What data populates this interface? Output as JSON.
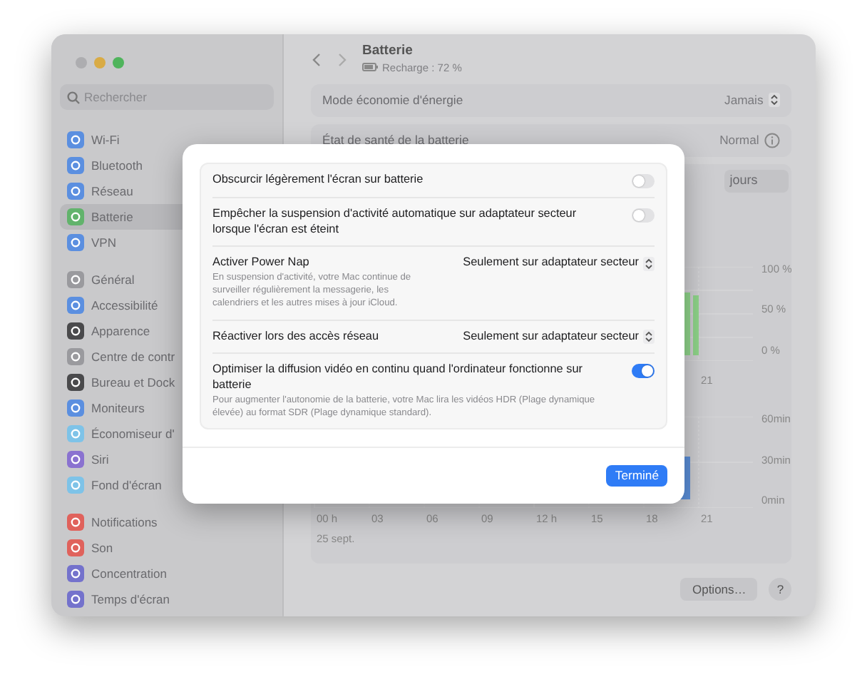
{
  "sidebar": {
    "search": {
      "placeholder": "Rechercher"
    },
    "groups": [
      {
        "items": [
          {
            "label": "Wi-Fi",
            "color": "#5b8fe0",
            "selected": false
          },
          {
            "label": "Bluetooth",
            "color": "#5b8fe0",
            "selected": false
          },
          {
            "label": "Réseau",
            "color": "#5b8fe0",
            "selected": false
          },
          {
            "label": "Batterie",
            "color": "#62b36c",
            "selected": true
          },
          {
            "label": "VPN",
            "color": "#5b8fe0",
            "selected": false
          }
        ]
      },
      {
        "items": [
          {
            "label": "Général",
            "color": "#9a9a9e",
            "selected": false
          },
          {
            "label": "Accessibilité",
            "color": "#5b8fe0",
            "selected": false
          },
          {
            "label": "Apparence",
            "color": "#4a4a4c",
            "selected": false
          },
          {
            "label": "Centre de contr",
            "color": "#9a9a9e",
            "selected": false
          },
          {
            "label": "Bureau et Dock",
            "color": "#4a4a4c",
            "selected": false
          },
          {
            "label": "Moniteurs",
            "color": "#5b8fe0",
            "selected": false
          },
          {
            "label": "Économiseur d'",
            "color": "#7ec3e8",
            "selected": false
          },
          {
            "label": "Siri",
            "color": "#8a72d0",
            "selected": false
          },
          {
            "label": "Fond d'écran",
            "color": "#7ec3e8",
            "selected": false
          }
        ]
      },
      {
        "items": [
          {
            "label": "Notifications",
            "color": "#e0625c",
            "selected": false
          },
          {
            "label": "Son",
            "color": "#e0625c",
            "selected": false
          },
          {
            "label": "Concentration",
            "color": "#7472cc",
            "selected": false
          },
          {
            "label": "Temps d'écran",
            "color": "#7472cc",
            "selected": false
          }
        ]
      }
    ]
  },
  "header": {
    "title": "Batterie",
    "subtitle": "Recharge : 72 %"
  },
  "settings": [
    {
      "label": "Mode économie d'énergie",
      "value": "Jamais",
      "kind": "popup"
    },
    {
      "label": "État de santé de la batterie",
      "value": "Normal",
      "kind": "info"
    }
  ],
  "range_tabs": [
    {
      "label": "jours",
      "selected": false
    }
  ],
  "level_chart": {
    "y_ticks": [
      "100 %",
      "50 %",
      "0 %"
    ],
    "x_ticks": [
      "21"
    ]
  },
  "usage_chart": {
    "y_ticks": [
      "60min",
      "30min",
      "0min"
    ],
    "x_ticks": [
      "00 h",
      "03",
      "06",
      "09",
      "12 h",
      "15",
      "18",
      "21"
    ],
    "date": "25 sept."
  },
  "footer_buttons": [
    {
      "label": "Options…"
    },
    {
      "label": "?"
    }
  ],
  "dialog": {
    "rows": [
      {
        "kind": "toggle",
        "label": "Obscurcir légèrement l'écran sur batterie",
        "on": false
      },
      {
        "kind": "toggle",
        "label": "Empêcher la suspension d'activité automatique sur adaptateur secteur lorsque l'écran est éteint",
        "on": false
      },
      {
        "kind": "popup",
        "label": "Activer Power Nap",
        "description": "En suspension d'activité, votre Mac continue de surveiller régulièrement la messagerie, les calendriers et les autres mises à jour iCloud.",
        "value": "Seulement sur adaptateur secteur"
      },
      {
        "kind": "popup",
        "label": "Réactiver lors des accès réseau",
        "value": "Seulement sur adaptateur secteur"
      },
      {
        "kind": "toggle",
        "label": "Optimiser la diffusion vidéo en continu quand l'ordinateur fonctionne sur batterie",
        "description": "Pour augmenter l'autonomie de la batterie, votre Mac lira les vidéos HDR (Plage dynamique élevée) au format SDR (Plage dynamique standard).",
        "on": true
      }
    ],
    "done_button": "Terminé"
  }
}
